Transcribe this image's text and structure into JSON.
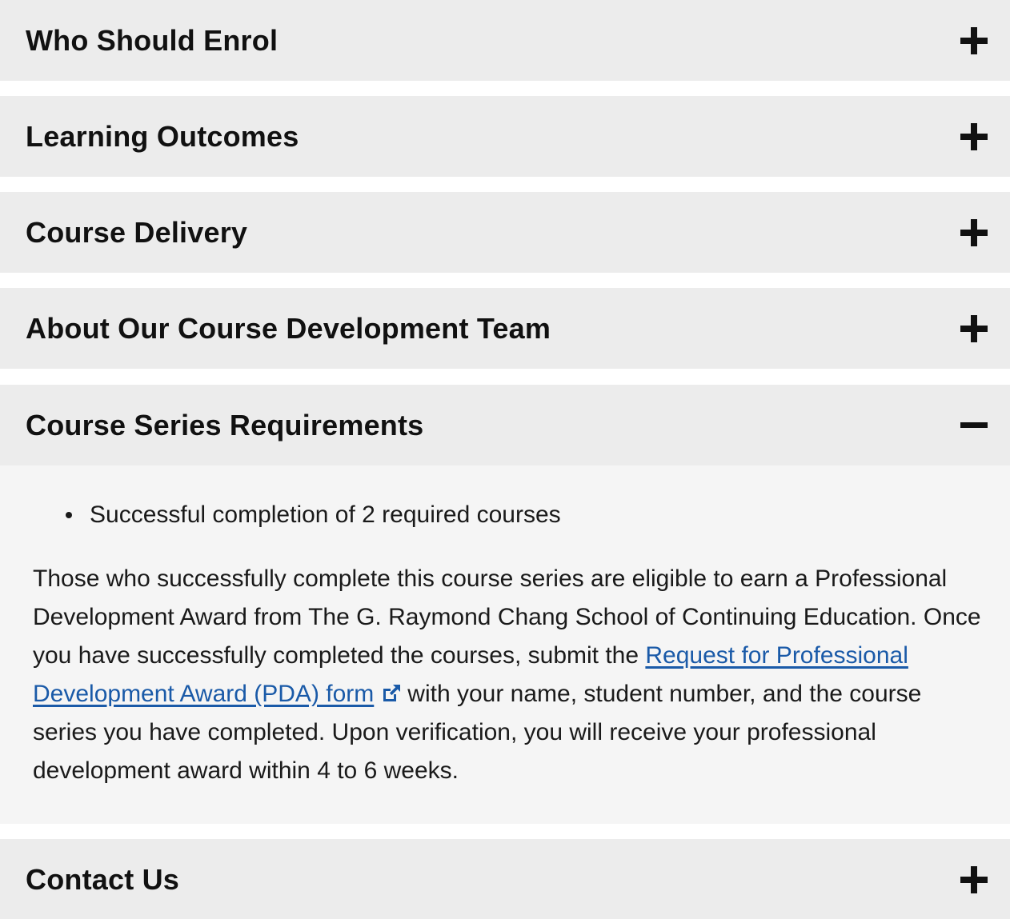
{
  "accordion": {
    "items": [
      {
        "title": "Who Should Enrol",
        "toggle_icon": "plus-icon"
      },
      {
        "title": "Learning Outcomes",
        "toggle_icon": "plus-icon"
      },
      {
        "title": "Course Delivery",
        "toggle_icon": "plus-icon"
      },
      {
        "title": "About Our Course Development Team",
        "toggle_icon": "plus-icon"
      },
      {
        "title": "Course Series Requirements",
        "toggle_icon": "minus-icon",
        "expanded": true
      },
      {
        "title": "Contact Us",
        "toggle_icon": "plus-icon"
      }
    ],
    "expanded_content": {
      "bullets": [
        "Successful completion of 2 required courses"
      ],
      "paragraph_before_link": "Those who successfully complete this course series are eligible to earn a Professional Development Award from The G. Raymond Chang School of Continuing Education. Once you have successfully completed the courses, submit the ",
      "link_text": "Request for Professional Development Award (PDA) form",
      "link_icon": "external-link-icon",
      "paragraph_after_link": "with your name, student number, and the course series you have completed. Upon verification, you will receive your professional development award within 4 to 6 weeks."
    }
  },
  "colors": {
    "header_bg": "#ececec",
    "body_bg": "#f5f5f5",
    "text": "#111111",
    "link": "#1a5aa8"
  }
}
